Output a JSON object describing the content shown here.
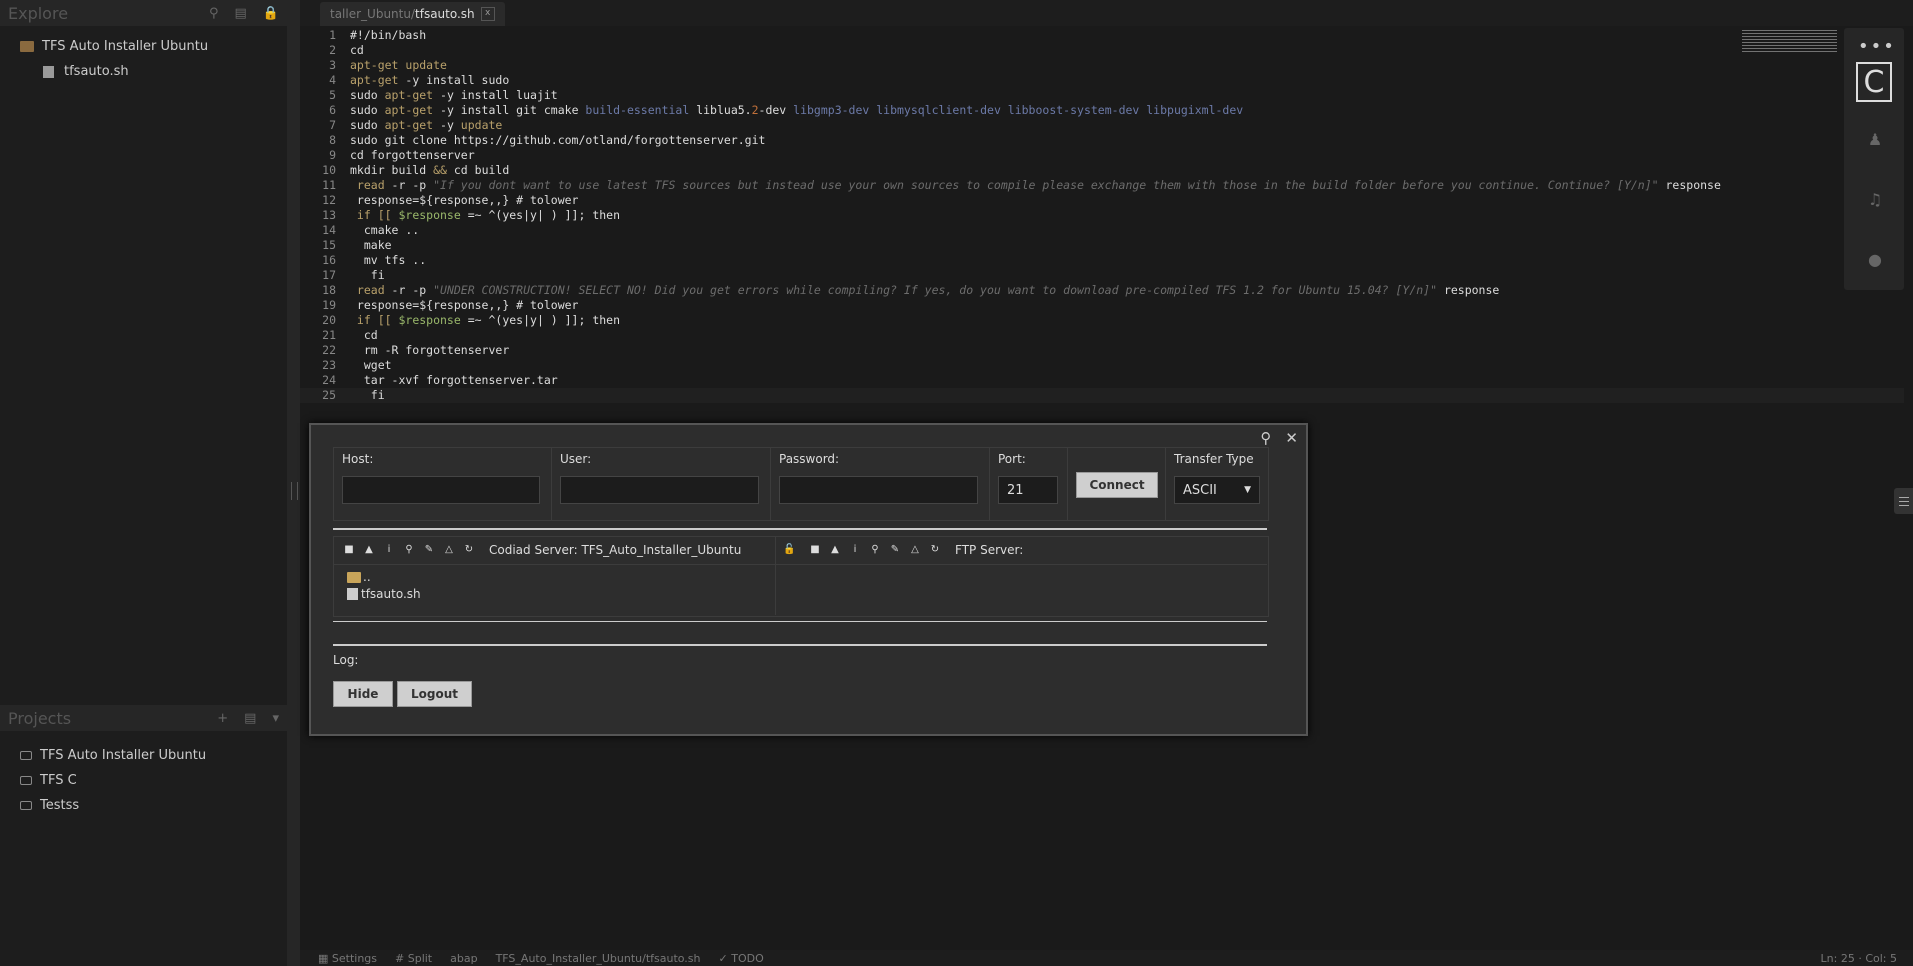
{
  "explore": {
    "title": "Explore",
    "icons": [
      "search-icon",
      "box-icon",
      "lock-icon"
    ]
  },
  "file_tree": [
    {
      "label": "TFS Auto Installer Ubuntu",
      "type": "folder"
    },
    {
      "label": "tfsauto.sh",
      "type": "file"
    }
  ],
  "projects": {
    "title": "Projects",
    "items": [
      "TFS Auto Installer Ubuntu",
      "TFS C",
      "Testss"
    ]
  },
  "tab": {
    "path": "taller_Ubuntu/",
    "name": "tfsauto.sh",
    "close": "x"
  },
  "code_lines": [
    {
      "n": "1"
    },
    {
      "n": "2"
    },
    {
      "n": "3"
    },
    {
      "n": "4"
    },
    {
      "n": "5"
    },
    {
      "n": "6"
    },
    {
      "n": "7"
    },
    {
      "n": "8"
    },
    {
      "n": "9"
    },
    {
      "n": "10"
    },
    {
      "n": "11"
    },
    {
      "n": "12"
    },
    {
      "n": "13"
    },
    {
      "n": "14"
    },
    {
      "n": "15"
    },
    {
      "n": "16"
    },
    {
      "n": "17"
    },
    {
      "n": "18"
    },
    {
      "n": "19"
    },
    {
      "n": "20"
    },
    {
      "n": "21"
    },
    {
      "n": "22"
    },
    {
      "n": "23"
    },
    {
      "n": "24"
    },
    {
      "n": "25"
    }
  ],
  "code": {
    "l1": "#!/bin/bash",
    "l2": "cd",
    "l3a": "apt-get",
    "l3b": " update",
    "l4a": "apt-get",
    "l4b": " -y install sudo",
    "l5a": "sudo ",
    "l5b": "apt-get",
    "l5c": " -y install luajit",
    "l6a": "sudo ",
    "l6b": "apt-get",
    "l6c": " -y install git cmake ",
    "l6d": "build-essential",
    "l6e": " liblua5.",
    "l6f": "2",
    "l6g": "-dev ",
    "l6h": "libgmp3-dev libmysqlclient-dev libboost-system-dev libpugixml-dev",
    "l7a": "sudo ",
    "l7b": "apt-get",
    "l7c": " -y ",
    "l7d": "update",
    "l8": "sudo git clone https://github.com/otland/forgottenserver.git",
    "l9": "cd forgottenserver",
    "l10a": "mkdir build ",
    "l10b": "&&",
    "l10c": " cd build",
    "l11a": " read",
    "l11b": " -r -p ",
    "l11c": "\"If you dont want to use latest TFS sources but instead use your own sources to compile please exchange them with those in the build folder before you continue. Continue? [Y/n]\"",
    "l11d": " response",
    "l12": " response=${response,,} # tolower",
    "l13a": " if [[ ",
    "l13b": "$response",
    "l13c": " =~ ^(yes|y| ) ]]; then",
    "l14": "  cmake ..",
    "l15": "  make",
    "l16": "  mv tfs ..",
    "l17": "   fi",
    "l18a": " read",
    "l18b": " -r -p ",
    "l18c": "\"UNDER CONSTRUCTION! SELECT NO! Did you get errors while compiling? If yes, do you want to download pre-compiled TFS 1.2 for Ubuntu 15.04? [Y/n]\"",
    "l18d": " response",
    "l19": " response=${response,,} # tolower",
    "l20a": " if [[ ",
    "l20b": "$response",
    "l20c": " =~ ^(yes|y| ) ]]; then",
    "l21": "  cd",
    "l22": "  rm -R forgottenserver",
    "l23": "  wget",
    "l24": "  tar -xvf forgottenserver.tar",
    "l25": "   fi"
  },
  "ftp": {
    "host_label": "Host:",
    "user_label": "User:",
    "password_label": "Password:",
    "port_label": "Port:",
    "port_value": "21",
    "connect_label": "Connect",
    "transfer_label": "Transfer Type",
    "transfer_value": "ASCII",
    "codiad_server": "Codiad Server: TFS_Auto_Installer_Ubuntu",
    "ftp_server": "FTP Server:",
    "parent_dir": "..",
    "file": "tfsauto.sh",
    "log_label": "Log:",
    "hide_label": "Hide",
    "logout_label": "Logout"
  },
  "statusbar": {
    "settings": "Settings",
    "split": "Split",
    "mode": "abap",
    "path": "TFS_Auto_Installer_Ubuntu/tfsauto.sh",
    "todo": "TODO",
    "position": "Ln: 25 · Col: 5"
  }
}
